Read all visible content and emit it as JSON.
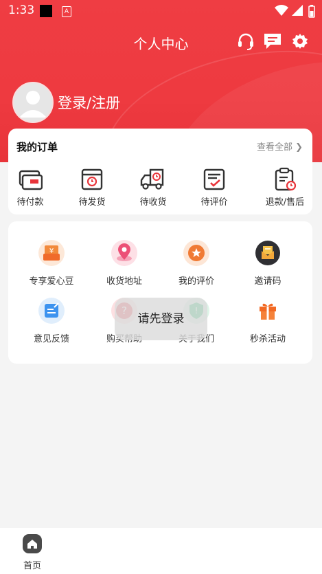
{
  "status_bar": {
    "time": "1:33",
    "a_icon_text": "A"
  },
  "header": {
    "title": "个人中心",
    "icons": [
      "headset-icon",
      "message-icon",
      "gear-icon"
    ]
  },
  "user": {
    "login_label": "登录/注册"
  },
  "orders": {
    "title": "我的订单",
    "view_all": "查看全部",
    "items": [
      {
        "label": "待付款",
        "icon": "wallet-icon"
      },
      {
        "label": "待发货",
        "icon": "box-clock-icon"
      },
      {
        "label": "待收货",
        "icon": "truck-icon"
      },
      {
        "label": "待评价",
        "icon": "review-icon"
      },
      {
        "label": "退款/售后",
        "icon": "refund-icon"
      }
    ]
  },
  "services": {
    "items": [
      {
        "label": "专享爱心豆",
        "icon": "coupon-icon"
      },
      {
        "label": "收货地址",
        "icon": "location-icon"
      },
      {
        "label": "我的评价",
        "icon": "star-icon"
      },
      {
        "label": "邀请码",
        "icon": "mail-icon"
      },
      {
        "label": "意见反馈",
        "icon": "feedback-icon"
      },
      {
        "label": "购买帮助",
        "icon": "help-icon"
      },
      {
        "label": "关于我们",
        "icon": "shield-icon"
      },
      {
        "label": "秒杀活动",
        "icon": "gift-icon"
      }
    ]
  },
  "toast": {
    "text": "请先登录"
  },
  "tabbar": {
    "home_label": "首页"
  },
  "colors": {
    "brand_red": "#ee3a40",
    "background": "#f4f4f4"
  }
}
